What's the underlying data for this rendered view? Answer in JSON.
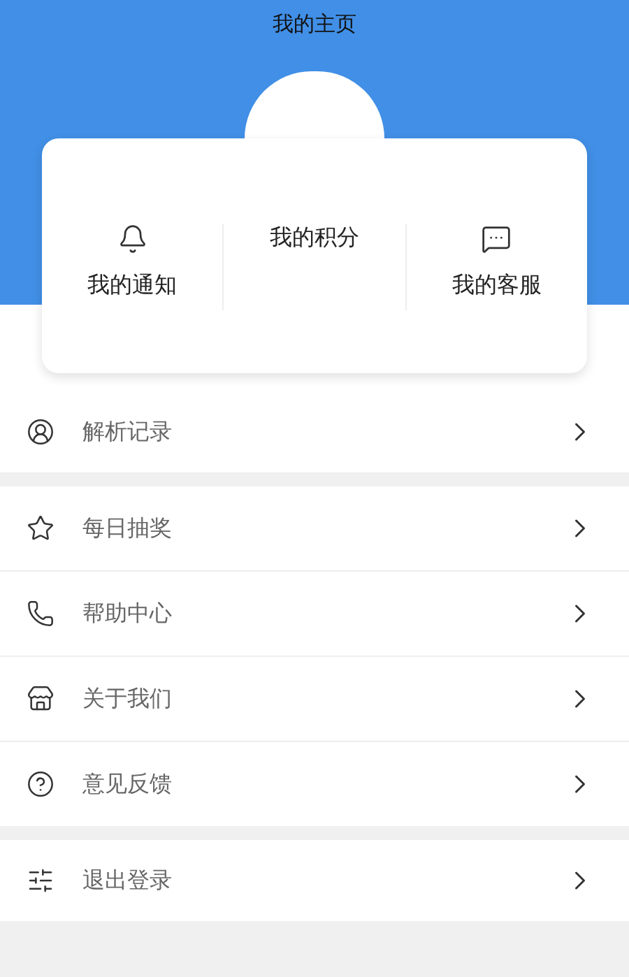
{
  "title": "我的主页",
  "stats": [
    {
      "label": "我的通知"
    },
    {
      "label": "我的积分"
    },
    {
      "label": "我的客服"
    }
  ],
  "menu_groups": [
    [
      {
        "label": "解析记录"
      }
    ],
    [
      {
        "label": "每日抽奖"
      },
      {
        "label": "帮助中心"
      },
      {
        "label": "关于我们"
      },
      {
        "label": "意见反馈"
      }
    ],
    [
      {
        "label": "退出登录"
      }
    ]
  ]
}
